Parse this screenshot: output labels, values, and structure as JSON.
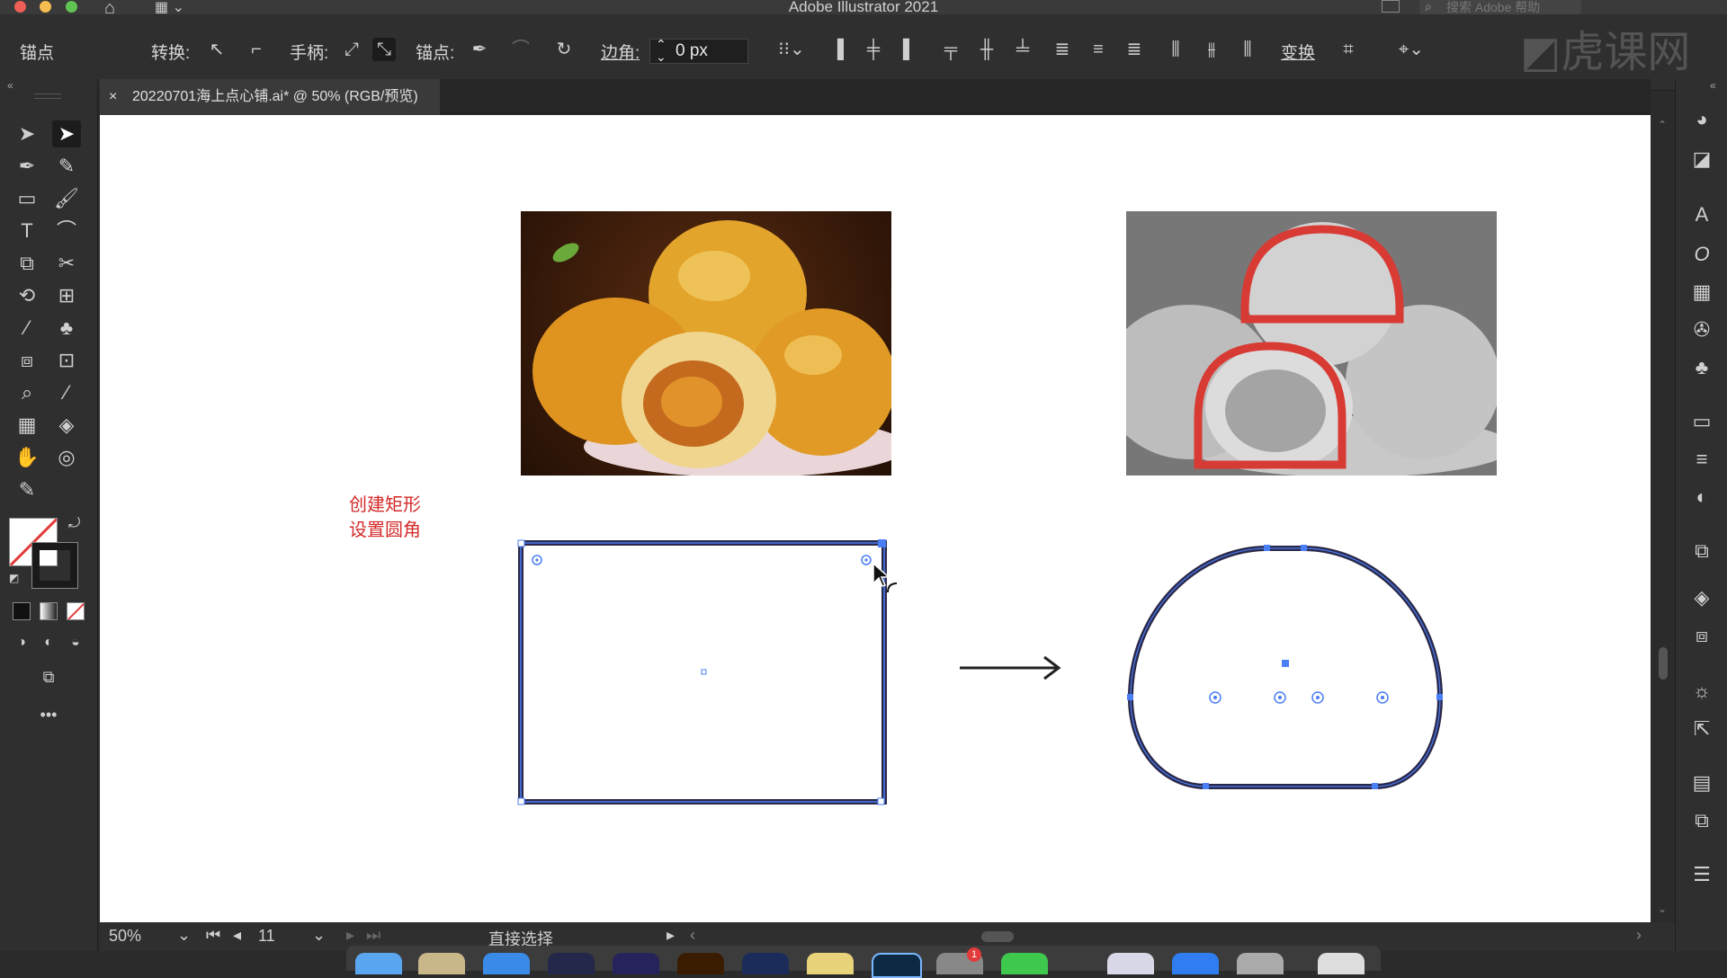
{
  "window": {
    "title": "Adobe Illustrator 2021",
    "help_placeholder": "搜索 Adobe 帮助"
  },
  "controlbar": {
    "mode_label": "锚点",
    "convert_label": "转换:",
    "handles_label": "手柄:",
    "anchors_label": "锚点:",
    "corner_label": "边角:",
    "corner_value": "0 px",
    "transform_label": "变换"
  },
  "document": {
    "tab_title": "20220701海上点心铺.ai* @ 50% (RGB/预览)",
    "close_icon": "×"
  },
  "canvas": {
    "note_line1": "创建矩形",
    "note_line2": "设置圆角"
  },
  "status": {
    "zoom": "50%",
    "page": "11",
    "tool_name": "直接选择"
  },
  "watermark": {
    "text": "虎课网"
  },
  "colors": {
    "accent": "#4a7ef5",
    "path_stroke": "#2a2848",
    "note_red": "#d42a2a"
  },
  "dock": {
    "badge": "1"
  }
}
